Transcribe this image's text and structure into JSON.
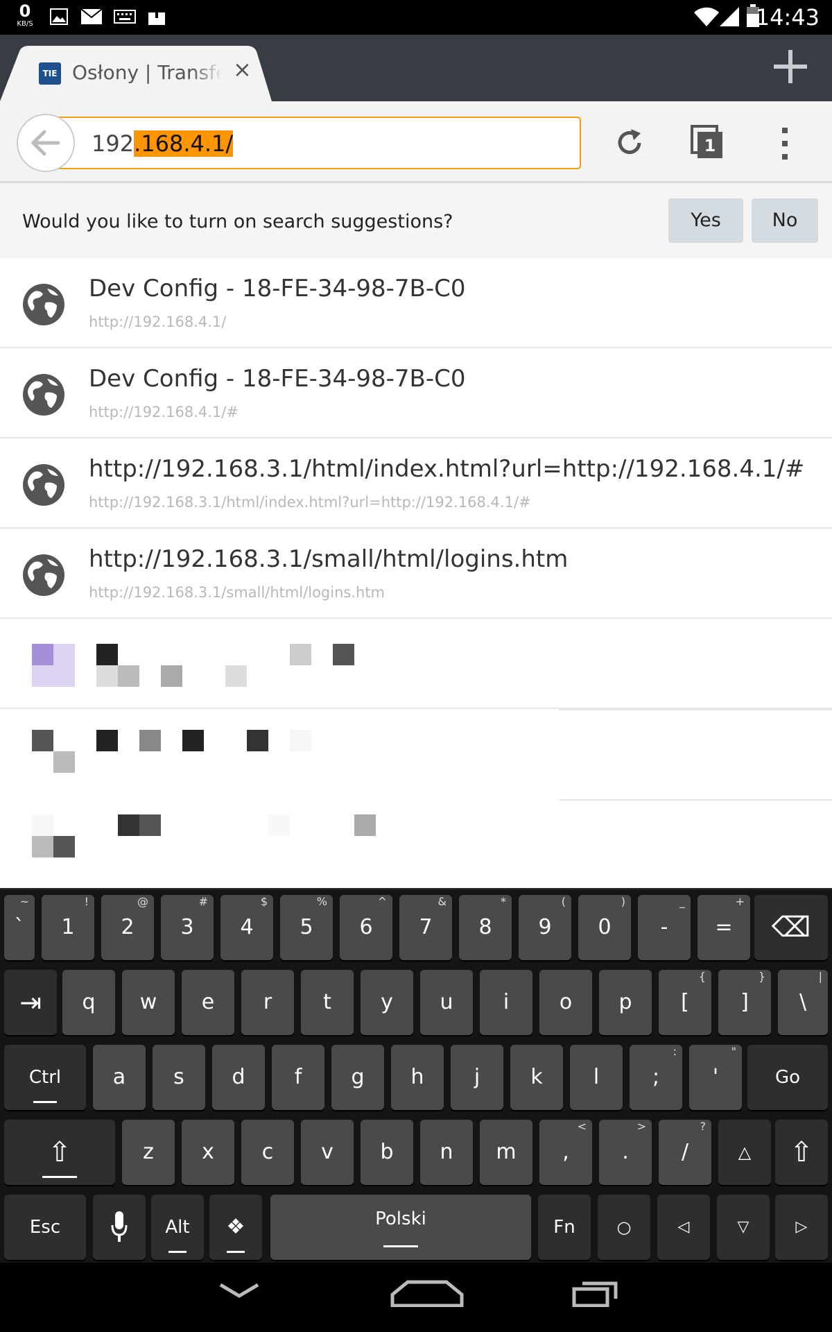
{
  "status_bar": {
    "net_speed_value": "0",
    "net_speed_unit": "KB/S",
    "time": "14:43"
  },
  "tab": {
    "favicon_text": "TIE",
    "title": "Osłony | Transfer",
    "close_glyph": "×"
  },
  "url_bar": {
    "prefix": "192",
    "selected": ".168.4.1/"
  },
  "tab_count": "1",
  "suggestion_prompt": {
    "question": "Would you like to turn on search suggestions?",
    "yes": "Yes",
    "no": "No"
  },
  "results": [
    {
      "title": "Dev Config - 18-FE-34-98-7B-C0",
      "url": "http://192.168.4.1/"
    },
    {
      "title": "Dev Config - 18-FE-34-98-7B-C0",
      "url": "http://192.168.4.1/#"
    },
    {
      "title": "http://192.168.3.1/html/index.html?url=http://192.168.4.1/#",
      "url": "http://192.168.3.1/html/index.html?url=http://192.168.4.1/#"
    },
    {
      "title": "http://192.168.3.1/small/html/logins.htm",
      "url": "http://192.168.3.1/small/html/logins.htm"
    }
  ],
  "keyboard": {
    "row1": [
      {
        "label": "`",
        "hint": "~"
      },
      {
        "label": "1",
        "hint": "!"
      },
      {
        "label": "2",
        "hint": "@"
      },
      {
        "label": "3",
        "hint": "#"
      },
      {
        "label": "4",
        "hint": "$"
      },
      {
        "label": "5",
        "hint": "%"
      },
      {
        "label": "6",
        "hint": "^"
      },
      {
        "label": "7",
        "hint": "&"
      },
      {
        "label": "8",
        "hint": "*"
      },
      {
        "label": "9",
        "hint": "("
      },
      {
        "label": "0",
        "hint": ")"
      },
      {
        "label": "-",
        "hint": "_"
      },
      {
        "label": "=",
        "hint": "+"
      }
    ],
    "row2": [
      {
        "label": "q"
      },
      {
        "label": "w"
      },
      {
        "label": "e"
      },
      {
        "label": "r"
      },
      {
        "label": "t"
      },
      {
        "label": "y"
      },
      {
        "label": "u"
      },
      {
        "label": "i"
      },
      {
        "label": "o"
      },
      {
        "label": "p"
      },
      {
        "label": "[",
        "hint": "{"
      },
      {
        "label": "]",
        "hint": "}"
      },
      {
        "label": "\\",
        "hint": "|"
      }
    ],
    "row3": [
      {
        "label": "a"
      },
      {
        "label": "s"
      },
      {
        "label": "d"
      },
      {
        "label": "f"
      },
      {
        "label": "g"
      },
      {
        "label": "h"
      },
      {
        "label": "j"
      },
      {
        "label": "k"
      },
      {
        "label": "l"
      },
      {
        "label": ";",
        "hint": ":"
      },
      {
        "label": "'",
        "hint": "\""
      }
    ],
    "row4": [
      {
        "label": "z"
      },
      {
        "label": "x"
      },
      {
        "label": "c"
      },
      {
        "label": "v"
      },
      {
        "label": "b"
      },
      {
        "label": "n"
      },
      {
        "label": "m"
      },
      {
        "label": ",",
        "hint": "<"
      },
      {
        "label": ".",
        "hint": ">"
      },
      {
        "label": "/",
        "hint": "?"
      }
    ],
    "ctrl": "Ctrl",
    "go": "Go",
    "esc": "Esc",
    "alt": "Alt",
    "space": "Polski",
    "fn": "Fn",
    "tab_glyph": "⇥",
    "backspace_glyph": "⌫",
    "shift_glyph": "⇧",
    "up_glyph": "△",
    "down_glyph": "▽",
    "left_glyph": "◁",
    "right_glyph": "▷",
    "circle_glyph": "○",
    "settings_glyph": "❖",
    "mic_icon": "microphone-icon"
  },
  "colors": {
    "url_selection": "#ff9500",
    "url_border": "#f39c12",
    "toolbar_bg": "#f3f3f3",
    "tabstrip_bg": "#383d43",
    "key_bg": "#4a4a4a"
  }
}
